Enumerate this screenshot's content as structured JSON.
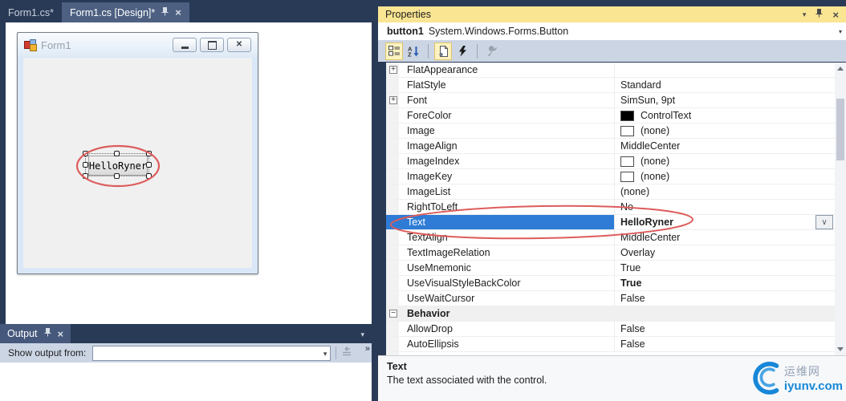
{
  "editor": {
    "tabs": [
      {
        "label": "Form1.cs*",
        "active": false
      },
      {
        "label": "Form1.cs [Design]*",
        "active": true
      }
    ],
    "form": {
      "title": "Form1",
      "button_text": "HelloRyner"
    }
  },
  "output": {
    "title": "Output",
    "show_output_label": "Show output from:",
    "combo_value": ""
  },
  "properties": {
    "title": "Properties",
    "object_name": "button1",
    "object_type": "System.Windows.Forms.Button",
    "rows": [
      {
        "name": "FlatAppearance",
        "value": "",
        "expander": "plus"
      },
      {
        "name": "FlatStyle",
        "value": "Standard"
      },
      {
        "name": "Font",
        "value": "SimSun, 9pt",
        "expander": "plus"
      },
      {
        "name": "ForeColor",
        "value": "ControlText",
        "swatch": "#000000"
      },
      {
        "name": "Image",
        "value": "(none)",
        "swatch": "#ffffff"
      },
      {
        "name": "ImageAlign",
        "value": "MiddleCenter"
      },
      {
        "name": "ImageIndex",
        "value": "(none)",
        "swatch": "#ffffff"
      },
      {
        "name": "ImageKey",
        "value": "(none)",
        "swatch": "#ffffff"
      },
      {
        "name": "ImageList",
        "value": "(none)"
      },
      {
        "name": "RightToLeft",
        "value": "No"
      },
      {
        "name": "Text",
        "value": "HelloRyner",
        "selected": true,
        "bold_value": true,
        "dropdown": true
      },
      {
        "name": "TextAlign",
        "value": "MiddleCenter"
      },
      {
        "name": "TextImageRelation",
        "value": "Overlay"
      },
      {
        "name": "UseMnemonic",
        "value": "True"
      },
      {
        "name": "UseVisualStyleBackColor",
        "value": "True",
        "bold_value": true
      },
      {
        "name": "UseWaitCursor",
        "value": "False"
      },
      {
        "name": "Behavior",
        "category": true,
        "expander": "minus"
      },
      {
        "name": "AllowDrop",
        "value": "False"
      },
      {
        "name": "AutoEllipsis",
        "value": "False"
      }
    ],
    "description_title": "Text",
    "description_text": "The text associated with the control."
  },
  "watermark": {
    "cn": "运维网",
    "site": "iyunv.com"
  },
  "icons": {
    "dropdown": "▾",
    "chevron_down": "∨",
    "close": "×",
    "overflow": "»",
    "expand": "+",
    "collapse": "−"
  },
  "colors": {
    "chrome": "#293a57",
    "tab_active": "#4d6082",
    "title_yellow": "#f9e592",
    "toolbar": "#ccd5e4",
    "highlight": "#2e7cd6",
    "annotation": "#dd5c5c",
    "link_blue": "#1787d8"
  }
}
